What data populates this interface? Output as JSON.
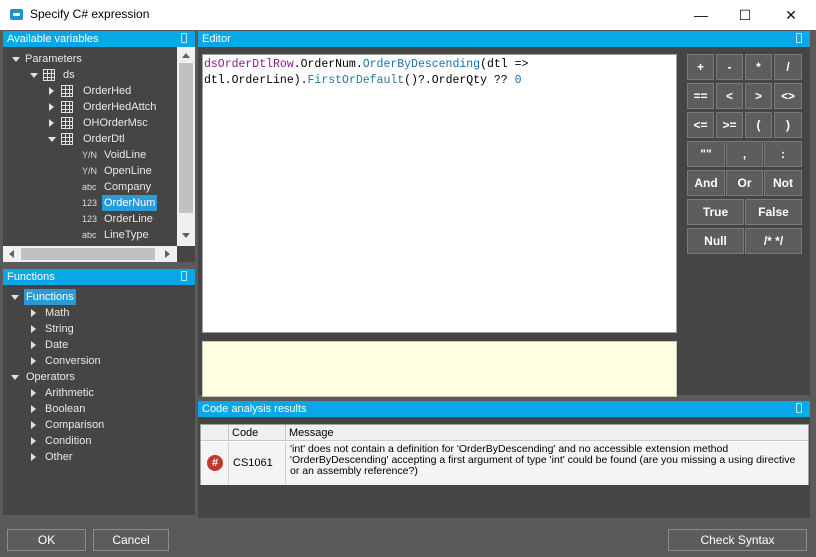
{
  "window": {
    "title": "Specify C# expression",
    "minimize": "—",
    "maximize": "☐",
    "close": "✕"
  },
  "variables_panel": {
    "title": "Available variables",
    "items": {
      "parameters": "Parameters",
      "ds": "ds",
      "orderhed": "OrderHed",
      "orderhedattch": "OrderHedAttch",
      "ohordermsc": "OHOrderMsc",
      "orderdtl": "OrderDtl",
      "voidline": {
        "type": "Y/N",
        "label": "VoidLine"
      },
      "openline": {
        "type": "Y/N",
        "label": "OpenLine"
      },
      "company": {
        "type": "abc",
        "label": "Company"
      },
      "ordernum": {
        "type": "123",
        "label": "OrderNum"
      },
      "orderline": {
        "type": "123",
        "label": "OrderLine"
      },
      "linetype": {
        "type": "abc",
        "label": "LineType"
      }
    }
  },
  "functions_panel": {
    "title": "Functions",
    "items": {
      "functions": "Functions",
      "math": "Math",
      "string": "String",
      "date": "Date",
      "conversion": "Conversion",
      "operators": "Operators",
      "arithmetic": "Arithmetic",
      "boolean": "Boolean",
      "comparison": "Comparison",
      "condition": "Condition",
      "other": "Other"
    }
  },
  "editor": {
    "title": "Editor",
    "line1": {
      "a": "dsOrderDtlRow",
      "b": ".OrderNum.",
      "c": "OrderByDescending",
      "d": "(dtl =>"
    },
    "line2": {
      "a": "dtl.OrderLine).",
      "b": "FirstOrDefault",
      "c": "()?.OrderQty ?? ",
      "d": "0"
    }
  },
  "operators": {
    "plus": "+",
    "minus": "-",
    "mult": "*",
    "div": "/",
    "eq": "==",
    "lt": "<",
    "gt": ">",
    "ne": "<>",
    "le": "<=",
    "ge": ">=",
    "lparen": "(",
    "rparen": ")",
    "quotes": "\"\"",
    "comma": ",",
    "colon": ":",
    "and": "And",
    "or": "Or",
    "not": "Not",
    "true": "True",
    "false": "False",
    "null": "Null",
    "comment": "/* */"
  },
  "code_analysis": {
    "title": "Code analysis results",
    "col_code": "Code",
    "col_message": "Message",
    "row": {
      "icon": "#",
      "code": "CS1061",
      "message": "'int' does not contain a definition for 'OrderByDescending' and no accessible extension method 'OrderByDescending' accepting a first argument of type 'int' could be found (are you missing a using directive or an assembly reference?)"
    }
  },
  "buttons": {
    "ok": "OK",
    "cancel": "Cancel",
    "check_syntax": "Check Syntax"
  },
  "colors": {
    "accent": "#08a8e8",
    "frame": "#5a5a5a",
    "selection": "#2b9ad8",
    "error": "#c0392b"
  }
}
